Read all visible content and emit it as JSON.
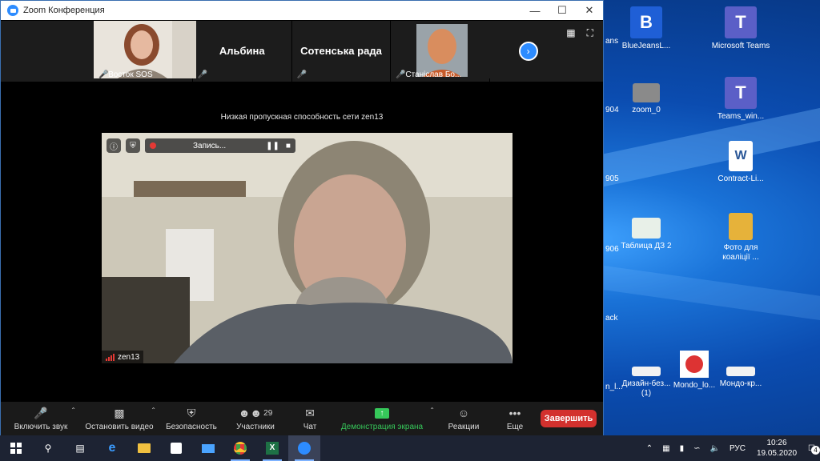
{
  "window": {
    "title": "Zoom Конференция"
  },
  "participants": [
    {
      "name": "Восток SOS",
      "has_video": true,
      "muted": true
    },
    {
      "name": "Альбина",
      "has_video": false,
      "muted": true
    },
    {
      "name": "Сотенська рада",
      "has_video": false,
      "muted": true
    },
    {
      "name": "Станіслав Бо...",
      "has_video": true,
      "muted": true
    }
  ],
  "main": {
    "notice": "Низкая пропускная способность сети zen13",
    "recording_label": "Запись...",
    "speaker_name": "zen13"
  },
  "toolbar": {
    "unmute": "Включить звук",
    "start_video": "Остановить видео",
    "security": "Безопасность",
    "participants": "Участники",
    "participants_count": "29",
    "chat": "Чат",
    "share": "Демонстрация экрана",
    "reactions": "Реакции",
    "more": "Еще",
    "end": "Завершить"
  },
  "desktop_icons": [
    {
      "label": "BlueJeansL...",
      "color": "#1f5fd6",
      "glyph": "B"
    },
    {
      "label": "Microsoft Teams",
      "color": "#5b5fc7",
      "glyph": "T"
    },
    {
      "label": "zoom_0",
      "color": "#8a8a8a",
      "glyph": ""
    },
    {
      "label": "Teams_win...",
      "color": "#5b5fc7",
      "glyph": "T"
    },
    {
      "label": "Contract-Li...",
      "color": "#ffffff",
      "glyph": "W"
    },
    {
      "label": "Таблица ДЗ 2",
      "color": "#e8f0e8",
      "glyph": ""
    },
    {
      "label": "Фото для коаліції ...",
      "color": "#e6b23a",
      "glyph": ""
    },
    {
      "label": "Дизайн-без... (1)",
      "color": "#f2f2f2",
      "glyph": ""
    },
    {
      "label": "Mondo_lo...",
      "color": "#ffffff",
      "glyph": ""
    },
    {
      "label": "Мондо-кр...",
      "color": "#f2f2f2",
      "glyph": ""
    }
  ],
  "desktop_edge_labels": [
    "ans",
    "904",
    "905",
    "906",
    "ack",
    "n_l..."
  ],
  "taskbar": {
    "language": "РУС",
    "time": "10:26",
    "date": "19.05.2020",
    "notifications": "4"
  },
  "colors": {
    "zoom_blue": "#2d8cff",
    "end_red": "#d3312e",
    "share_green": "#36c85a"
  }
}
